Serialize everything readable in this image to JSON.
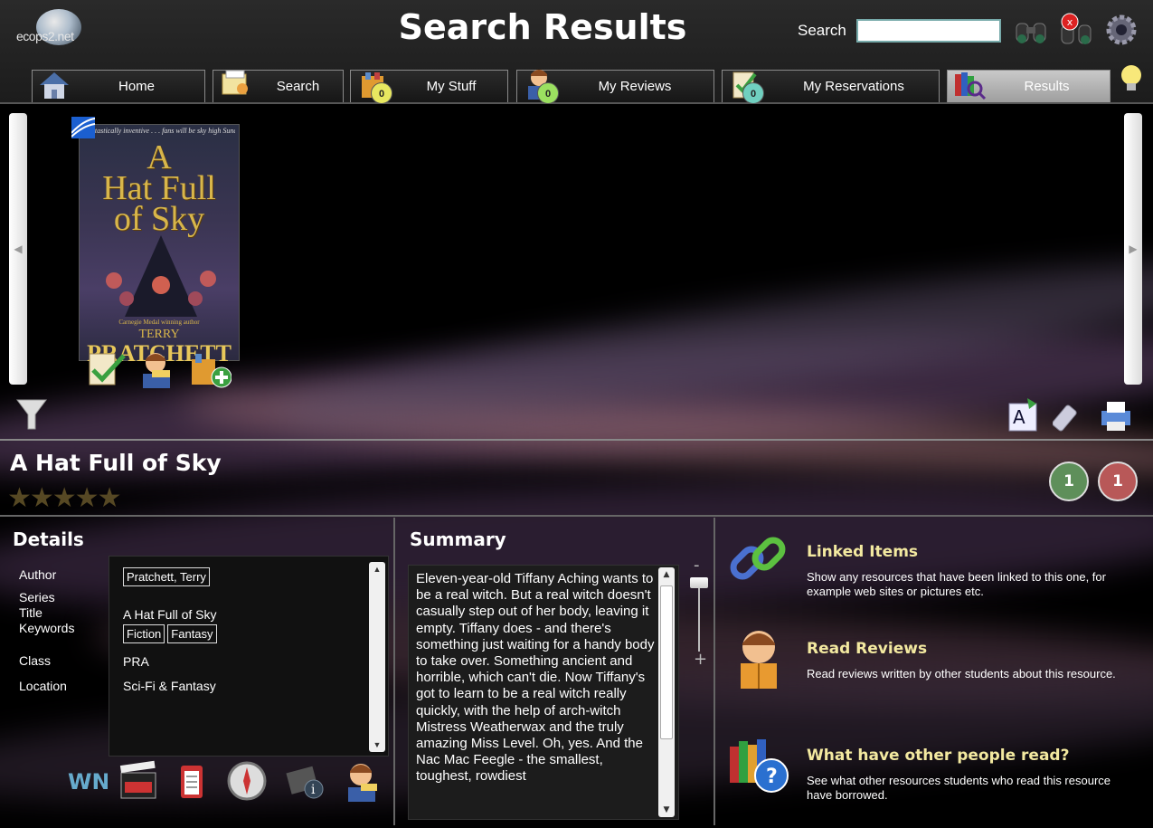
{
  "app": {
    "logo_text": "ecops2.net",
    "page_title": "Search Results"
  },
  "search": {
    "label": "Search",
    "value": ""
  },
  "header_icons": [
    "binoculars-icon",
    "clear-search-icon",
    "settings-gear-icon"
  ],
  "tabs": [
    {
      "label": "Home",
      "icon": "home-icon"
    },
    {
      "label": "Search",
      "icon": "search-catalogue-icon"
    },
    {
      "label": "My Stuff",
      "icon": "my-stuff-bag-icon",
      "badge": "0"
    },
    {
      "label": "My Reviews",
      "icon": "my-reviews-person-icon",
      "badge": "0"
    },
    {
      "label": "My Reservations",
      "icon": "reservations-clipboard-icon",
      "badge": "0"
    },
    {
      "label": "Results",
      "icon": "results-books-icon",
      "active": true
    }
  ],
  "book": {
    "cover_tagline": "Fantastically inventive . . . fans will be sky high   Sunday Times",
    "cover_title_lines": [
      "A",
      "Hat Full",
      "of Sky"
    ],
    "cover_caption": "Carnegie Medal winning author",
    "cover_author_first": "TERRY",
    "cover_author_last": "PRATCHETT",
    "title": "A Hat Full of Sky",
    "rating_stars": 0,
    "available_count": "1",
    "on_loan_count": "1"
  },
  "details": {
    "heading": "Details",
    "labels": {
      "author": "Author",
      "series": "Series",
      "title": "Title",
      "keywords": "Keywords",
      "class": "Class",
      "location": "Location"
    },
    "values": {
      "author": "Pratchett, Terry",
      "title": "A Hat Full of Sky",
      "keywords": [
        "Fiction",
        "Fantasy"
      ],
      "class": "PRA",
      "location": "Sci-Fi & Fantasy"
    }
  },
  "summary": {
    "heading": "Summary",
    "text": "Eleven-year-old Tiffany Aching wants to be a real witch. But a real witch doesn't casually step out of her body, leaving it empty. Tiffany does - and there's something just waiting for a handy body to take over. Something ancient and horrible, which can't die. Now Tiffany's got to learn to be a real witch really quickly, with the help of arch-witch Mistress Weatherwax and the truly amazing Miss Level. Oh, yes. And the Nac Mac Feegle - the smallest, toughest, rowdiest"
  },
  "zoom": {
    "minus": "-",
    "plus": "+"
  },
  "links": [
    {
      "title": "Linked Items",
      "desc": "Show any resources that have been linked to this one, for example web sites or pictures etc.",
      "icon": "chain-link-icon"
    },
    {
      "title": "Read Reviews",
      "desc": "Read reviews written by other students about this resource.",
      "icon": "reading-person-icon"
    },
    {
      "title": "What have other people read?",
      "desc": "See what other resources students who read this resource have borrowed.",
      "icon": "books-question-icon"
    }
  ],
  "colors": {
    "accent_title": "#f3e9a0",
    "available_green": "#5e8f5a",
    "onloan_red": "#b85858"
  }
}
